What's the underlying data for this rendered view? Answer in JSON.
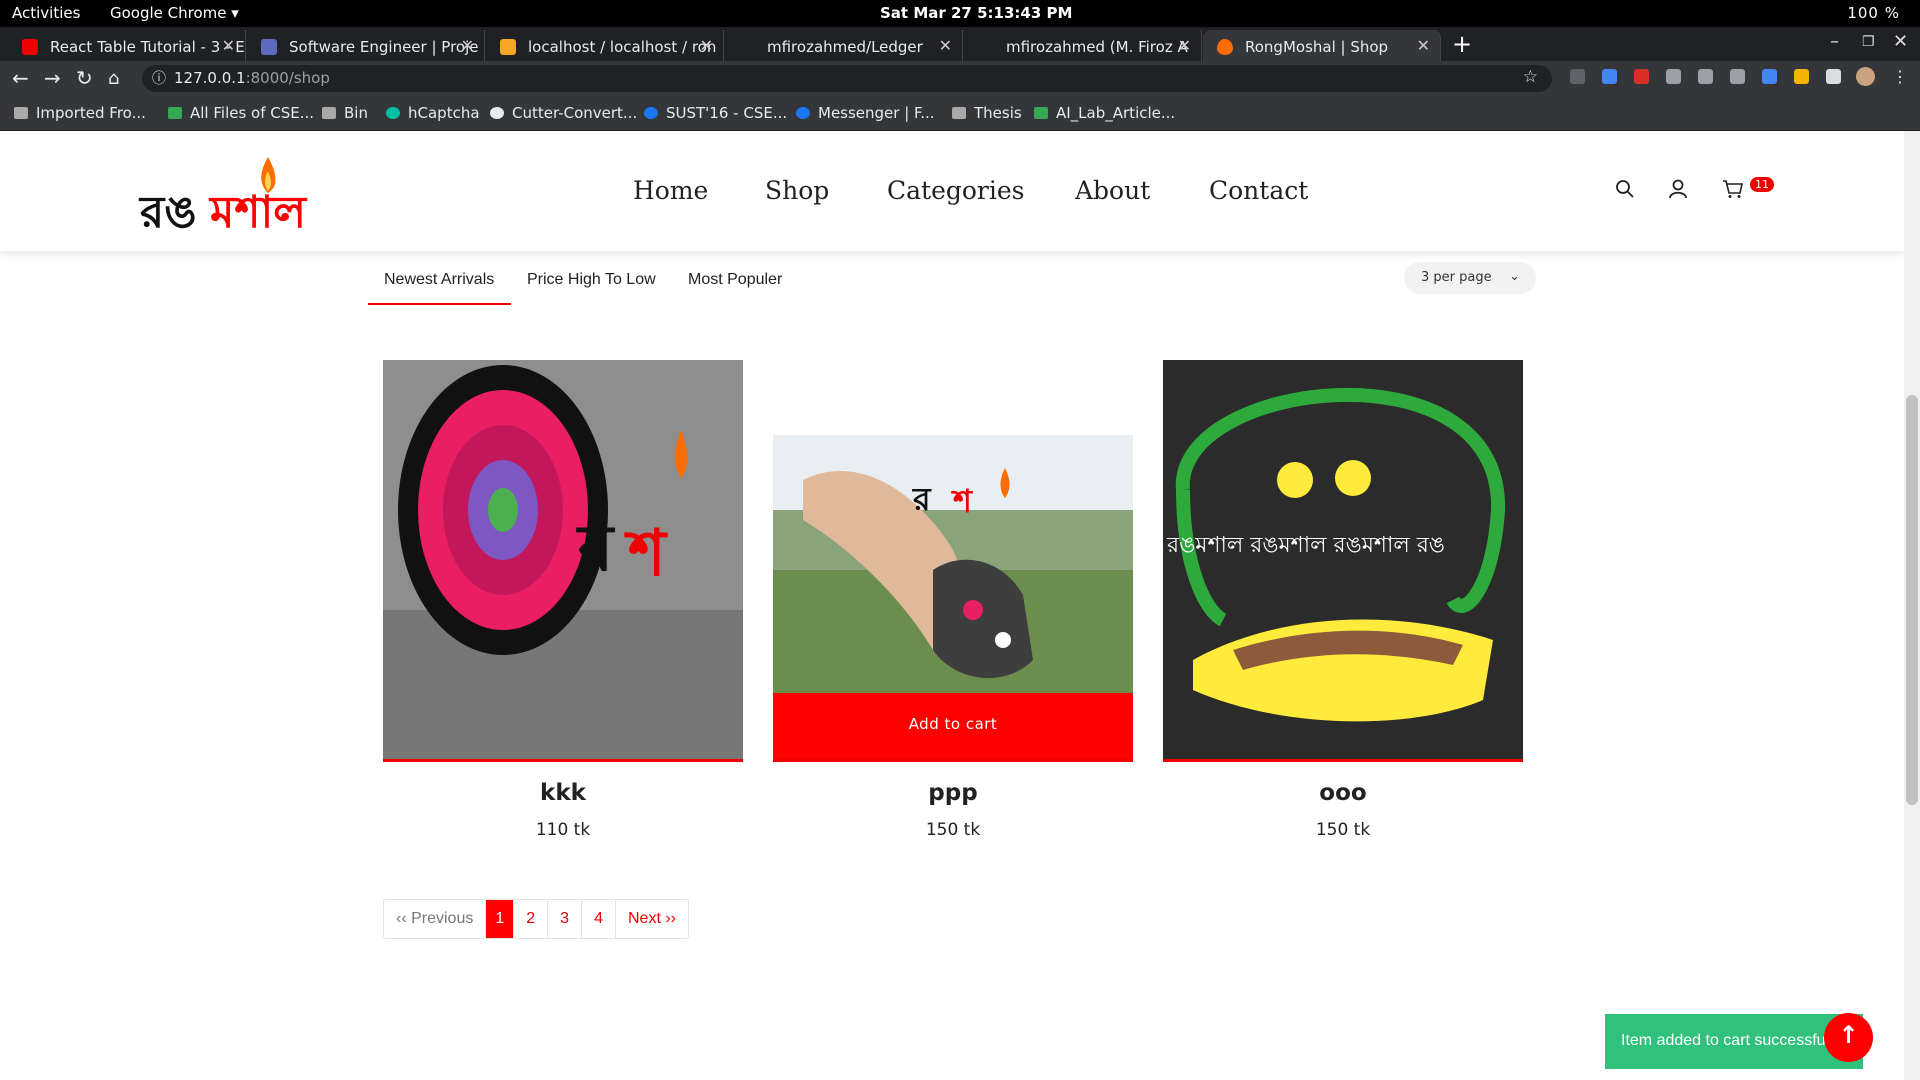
{
  "os": {
    "activities": "Activities",
    "app_menu": "Google Chrome ▾",
    "clock": "Sat Mar 27  5:13:43 PM",
    "status": "100 %"
  },
  "tabs": [
    {
      "title": "React Table Tutorial - 3 - E",
      "color": "#e00"
    },
    {
      "title": "Software Engineer | Proje",
      "color": "#5c6bc0"
    },
    {
      "title": "localhost / localhost / ron",
      "color": "#f5a623"
    },
    {
      "title": "mfirozahmed/Ledger",
      "color": "#202124"
    },
    {
      "title": "mfirozahmed (M. Firoz A",
      "color": "#202124"
    },
    {
      "title": "RongMoshal | Shop",
      "color": "#ff6d00"
    }
  ],
  "url": {
    "host": "127.0.0.1",
    "path": ":8000/shop"
  },
  "bookmarks": [
    "Imported Fro...",
    "All Files of CSE...",
    "Bin",
    "hCaptcha",
    "Cutter-Convert...",
    "SUST'16 - CSE...",
    "Messenger | F...",
    "Thesis",
    "AI_Lab_Article..."
  ],
  "site": {
    "logo_black": "রঙ",
    "logo_red": "মশাল",
    "nav": [
      "Home",
      "Shop",
      "Categories",
      "About",
      "Contact"
    ],
    "cart_count": "11"
  },
  "sort": {
    "options": [
      "Newest Arrivals",
      "Price High To Low",
      "Most Populer"
    ],
    "per_page": "3 per page"
  },
  "products": [
    {
      "name": "kkk",
      "price": "110 tk"
    },
    {
      "name": "ppp",
      "price": "150 tk",
      "cta": "Add to cart"
    },
    {
      "name": "ooo",
      "price": "150 tk",
      "overlay": "রঙমশাল রঙমশাল রঙমশাল রঙ"
    }
  ],
  "pagination": {
    "prev": "‹‹ Previous",
    "pages": [
      "1",
      "2",
      "3",
      "4"
    ],
    "current": "1",
    "next": "Next ››"
  },
  "toast": "Item added to cart successfully",
  "colors": {
    "brand_red": "#ff0000",
    "toast_green": "#30c27c"
  }
}
